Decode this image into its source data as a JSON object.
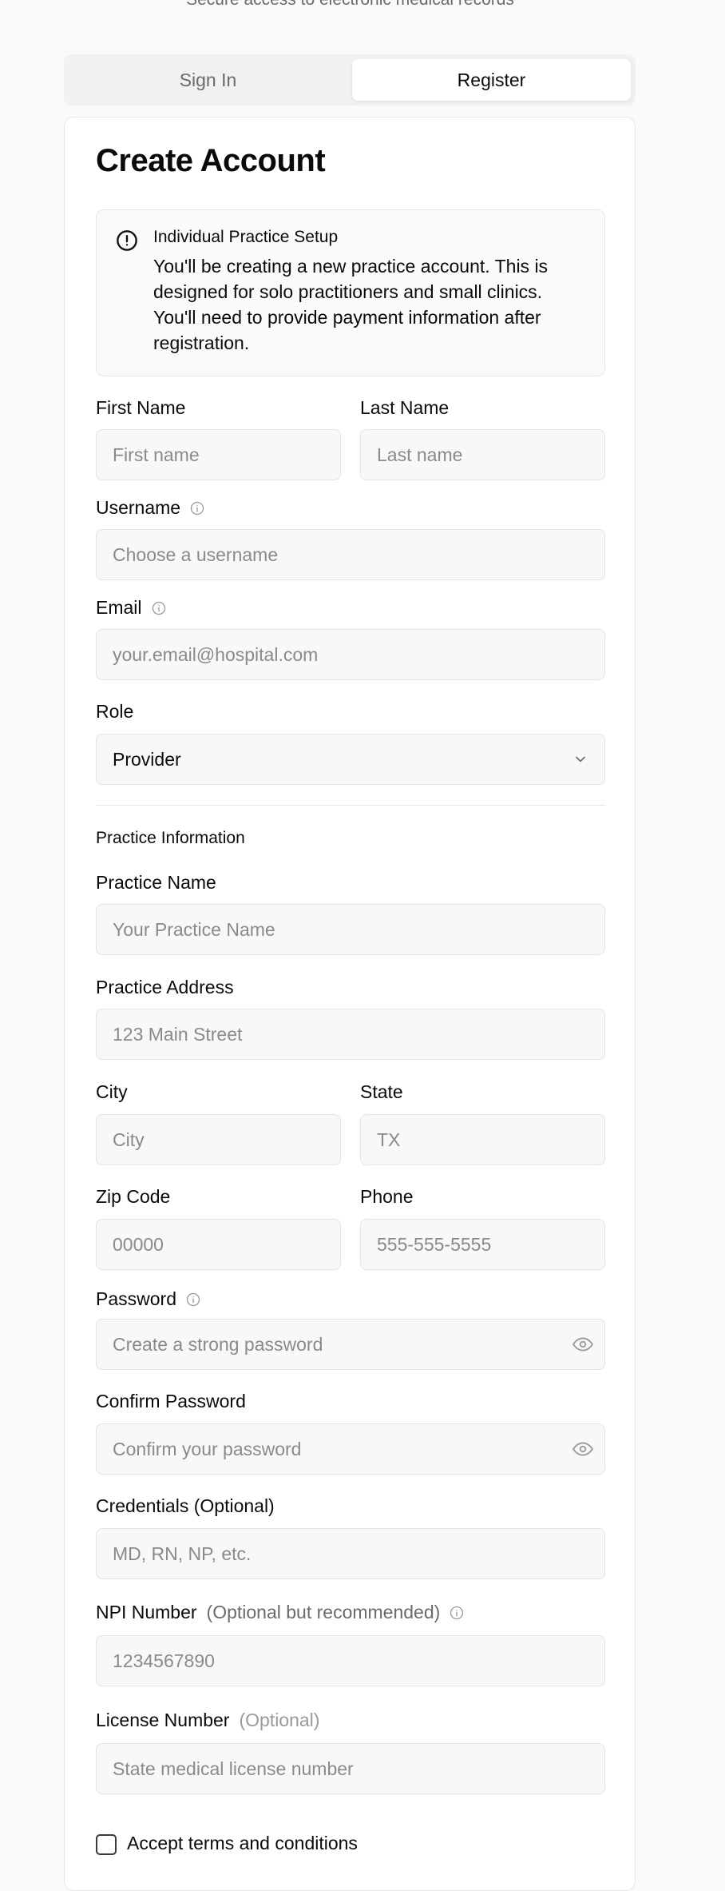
{
  "header": {
    "subtitle": "Secure access to electronic medical records"
  },
  "tabs": [
    {
      "label": "Sign In",
      "active": false
    },
    {
      "label": "Register",
      "active": true
    }
  ],
  "form": {
    "title": "Create Account",
    "alert": {
      "icon": "alert-circle-icon",
      "title": "Individual Practice Setup",
      "body": "You'll be creating a new practice account. This is designed for solo practitioners and small clinics. You'll need to provide payment information after registration."
    },
    "first_name": {
      "label": "First Name",
      "placeholder": "First name"
    },
    "last_name": {
      "label": "Last Name",
      "placeholder": "Last name"
    },
    "username": {
      "label": "Username",
      "placeholder": "Choose a username"
    },
    "email": {
      "label": "Email",
      "placeholder": "your.email@hospital.com"
    },
    "role": {
      "label": "Role",
      "value": "Provider"
    },
    "practice_section_title": "Practice Information",
    "practice_name": {
      "label": "Practice Name",
      "placeholder": "Your Practice Name"
    },
    "practice_address": {
      "label": "Practice Address",
      "placeholder": "123 Main Street"
    },
    "city": {
      "label": "City",
      "placeholder": "City"
    },
    "state": {
      "label": "State",
      "placeholder": "TX"
    },
    "zip": {
      "label": "Zip Code",
      "placeholder": "00000"
    },
    "phone": {
      "label": "Phone",
      "placeholder": "555-555-5555"
    },
    "password": {
      "label": "Password",
      "placeholder": "Create a strong password"
    },
    "confirm_password": {
      "label": "Confirm Password",
      "placeholder": "Confirm your password"
    },
    "credentials": {
      "label": "Credentials (Optional)",
      "placeholder": "MD, RN, NP, etc."
    },
    "npi": {
      "label": "NPI Number",
      "hint": "(Optional but recommended)",
      "placeholder": "1234567890"
    },
    "license": {
      "label": "License Number",
      "hint": "(Optional)",
      "placeholder": "State medical license number"
    },
    "terms_label": "Accept terms and conditions"
  },
  "colors": {
    "background": "#fafafa",
    "card": "#ffffff",
    "border": "#e6e6e6",
    "input_bg": "#f8f8f8",
    "muted_text": "#6b6b6b",
    "placeholder": "#8a8a8a"
  }
}
